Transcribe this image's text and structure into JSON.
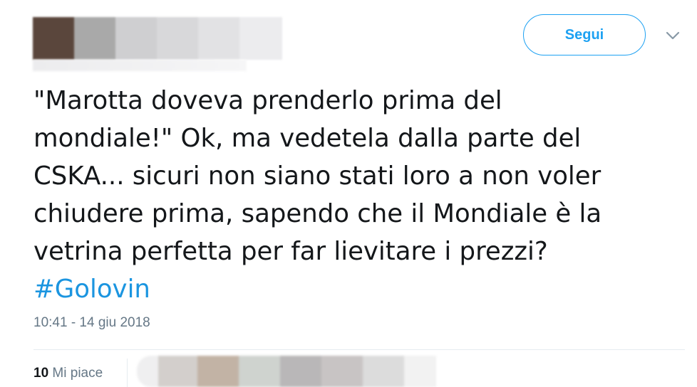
{
  "tweet": {
    "follow_label": "Segui",
    "text_lines": [
      "\"Marotta doveva prenderlo prima del",
      "mondiale!\" Ok, ma vedetela dalla parte del",
      "CSKA... sicuri non siano stati loro a non voler",
      "chiudere prima, sapendo che il Mondiale è la",
      "vetrina perfetta per far lievitare i prezzi?"
    ],
    "hashtag": "#Golovin",
    "timestamp": "10:41 - 14 giu 2018",
    "likes_count": "10",
    "likes_label": "Mi piace"
  },
  "colors": {
    "accent": "#1da1f2",
    "hashtag": "#1b95e0",
    "text": "#14171a",
    "muted": "#657786"
  },
  "icons": {
    "menu": "chevron-down-icon"
  }
}
